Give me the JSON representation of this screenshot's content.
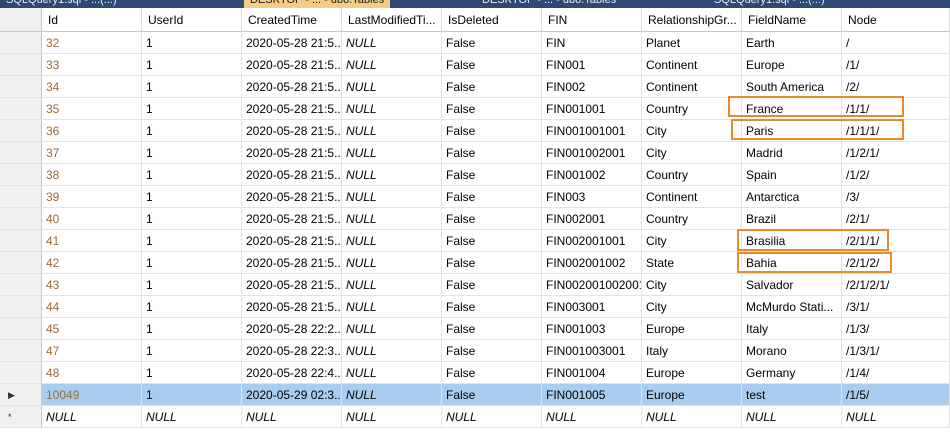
{
  "tabs": [
    "SQLQuery1.sql - ...(...)",
    "DESKTOP - ... - dbo.Tables",
    "DESKTOP - ... - dbo.Tables",
    "SQLQuery1.sql - ...(...)"
  ],
  "columns": [
    "Id",
    "UserId",
    "CreatedTime",
    "LastModifiedTi...",
    "IsDeleted",
    "FIN",
    "RelationshipGr...",
    "FieldName",
    "Node"
  ],
  "rows": [
    [
      "32",
      "1",
      "2020-05-28 21:5...",
      "NULL",
      "False",
      "FIN",
      "Planet",
      "Earth",
      "/"
    ],
    [
      "33",
      "1",
      "2020-05-28 21:5...",
      "NULL",
      "False",
      "FIN001",
      "Continent",
      "Europe",
      "/1/"
    ],
    [
      "34",
      "1",
      "2020-05-28 21:5...",
      "NULL",
      "False",
      "FIN002",
      "Continent",
      "South America",
      "/2/"
    ],
    [
      "35",
      "1",
      "2020-05-28 21:5...",
      "NULL",
      "False",
      "FIN001001",
      "Country",
      "France",
      "/1/1/"
    ],
    [
      "36",
      "1",
      "2020-05-28 21:5...",
      "NULL",
      "False",
      "FIN001001001",
      "City",
      "Paris",
      "/1/1/1/"
    ],
    [
      "37",
      "1",
      "2020-05-28 21:5...",
      "NULL",
      "False",
      "FIN001002001",
      "City",
      "Madrid",
      "/1/2/1/"
    ],
    [
      "38",
      "1",
      "2020-05-28 21:5...",
      "NULL",
      "False",
      "FIN001002",
      "Country",
      "Spain",
      "/1/2/"
    ],
    [
      "39",
      "1",
      "2020-05-28 21:5...",
      "NULL",
      "False",
      "FIN003",
      "Continent",
      "Antarctica",
      "/3/"
    ],
    [
      "40",
      "1",
      "2020-05-28 21:5...",
      "NULL",
      "False",
      "FIN002001",
      "Country",
      "Brazil",
      "/2/1/"
    ],
    [
      "41",
      "1",
      "2020-05-28 21:5...",
      "NULL",
      "False",
      "FIN002001001",
      "City",
      "Brasilia",
      "/2/1/1/"
    ],
    [
      "42",
      "1",
      "2020-05-28 21:5...",
      "NULL",
      "False",
      "FIN002001002",
      "State",
      "Bahia",
      "/2/1/2/"
    ],
    [
      "43",
      "1",
      "2020-05-28 21:5...",
      "NULL",
      "False",
      "FIN002001002001",
      "City",
      "Salvador",
      "/2/1/2/1/"
    ],
    [
      "44",
      "1",
      "2020-05-28 21:5...",
      "NULL",
      "False",
      "FIN003001",
      "City",
      "McMurdo Stati...",
      "/3/1/"
    ],
    [
      "45",
      "1",
      "2020-05-28 22:2...",
      "NULL",
      "False",
      "FIN001003",
      "Europe",
      "Italy",
      "/1/3/"
    ],
    [
      "47",
      "1",
      "2020-05-28 22:3...",
      "NULL",
      "False",
      "FIN001003001",
      "Italy",
      "Morano",
      "/1/3/1/"
    ],
    [
      "48",
      "1",
      "2020-05-28 22:4...",
      "NULL",
      "False",
      "FIN001004",
      "Europe",
      "Germany",
      "/1/4/"
    ],
    [
      "10049",
      "1",
      "2020-05-29 02:3...",
      "NULL",
      "False",
      "FIN001005",
      "Europe",
      "test",
      "/1/5/"
    ]
  ],
  "new_row": [
    "NULL",
    "NULL",
    "NULL",
    "NULL",
    "NULL",
    "NULL",
    "NULL",
    "NULL",
    "NULL"
  ],
  "selected_row_index": 16,
  "row_markers": {
    "selected": "▶",
    "new": "*"
  },
  "highlight_color": "#e88a2e",
  "selection_color": "#a9cdf0"
}
